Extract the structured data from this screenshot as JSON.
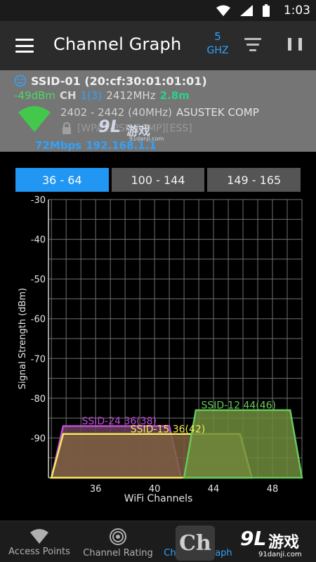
{
  "status_bar": {
    "time": "1:03"
  },
  "app_bar": {
    "title": "Channel Graph",
    "band_number": "5",
    "band_unit": "GHZ",
    "icons": [
      "menu-icon",
      "filter-icon",
      "pause-icon"
    ]
  },
  "access_point": {
    "ssid": "SSID-01 (20:cf:30:01:01:01)",
    "signal": "-49dBm",
    "ch_label": "CH",
    "channel": "1(3)",
    "frequency": "2412MHz",
    "distance": "2.8m",
    "range": "2402 - 2442 (40MHz)",
    "vendor": "ASUSTEK COMP",
    "security": "[WPA2-PSK-CCMP][ESS]",
    "link_speed": "72Mbps",
    "ip": "192.168.1.1"
  },
  "channel_tabs": [
    {
      "label": "36 - 64",
      "active": true
    },
    {
      "label": "100 - 144",
      "active": false
    },
    {
      "label": "149 - 165",
      "active": false
    }
  ],
  "chart_data": {
    "type": "area",
    "xlabel": "WiFi Channels",
    "ylabel": "Signal Strength (dBm)",
    "ylim": [
      -100,
      -30
    ],
    "xlim": [
      32.8,
      50
    ],
    "yticks": [
      -30,
      -40,
      -50,
      -60,
      -70,
      -80,
      -90
    ],
    "xticks": [
      36,
      40,
      44,
      48
    ],
    "grid": true,
    "series": [
      {
        "name": "SSID-24 36(38)",
        "color": "#c04fd8",
        "fill": "#6a3f5c",
        "x": [
          33.0,
          33.8,
          41.0,
          41.8
        ],
        "y": [
          -100,
          -87,
          -87,
          -100
        ]
      },
      {
        "name": "SSID-15 36(42)",
        "color": "#f2ea5a",
        "fill": "#7c5f40",
        "x": [
          33.0,
          33.8,
          45.8,
          46.6
        ],
        "y": [
          -100,
          -89,
          -89,
          -100
        ]
      },
      {
        "name": "SSID-12 44(46)",
        "color": "#67c85a",
        "fill": "#6e8c3b",
        "x": [
          42.0,
          42.8,
          49.2,
          50.0
        ],
        "y": [
          -100,
          -83,
          -83,
          -100
        ]
      }
    ],
    "labels": [
      {
        "text": "SSID-24 36(38)",
        "x": 37.6,
        "y": -86.6,
        "color": "#c04fd8"
      },
      {
        "text": "SSID-15 36(42)",
        "x": 40.9,
        "y": -88.6,
        "color": "#f2ea5a"
      },
      {
        "text": "SSID-12 44(46)",
        "x": 45.7,
        "y": -82.6,
        "color": "#67c85a"
      }
    ]
  },
  "bottom_nav": {
    "items": [
      {
        "label": "Access Points",
        "icon": "wifi-icon"
      },
      {
        "label": "Channel Rating",
        "icon": "antenna-icon"
      },
      {
        "label": "Channel Graph",
        "icon": "graph-icon",
        "active": true
      }
    ]
  },
  "watermark": {
    "logo_text": "9L",
    "brand": "游戏",
    "url": "91danji.com",
    "corner_logo": "Ch"
  }
}
